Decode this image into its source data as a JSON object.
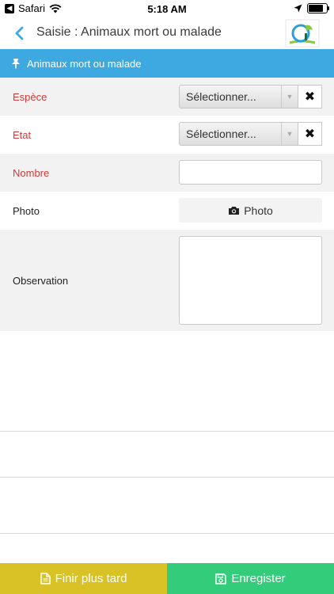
{
  "status_bar": {
    "app": "Safari",
    "time": "5:18 AM",
    "battery_level": 0.9
  },
  "nav": {
    "title": "Saisie : Animaux mort ou malade"
  },
  "section": {
    "title": "Animaux mort ou malade"
  },
  "form": {
    "espece": {
      "label": "Espèce",
      "value": "Sélectionner...",
      "clear": "✖"
    },
    "etat": {
      "label": "Etat",
      "value": "Sélectionner...",
      "clear": "✖"
    },
    "nombre": {
      "label": "Nombre",
      "value": ""
    },
    "photo": {
      "label": "Photo",
      "button": "Photo"
    },
    "observation": {
      "label": "Observation",
      "value": ""
    }
  },
  "footer": {
    "later_label": "Finir plus tard",
    "save_label": "Enregister"
  },
  "colors": {
    "header_blue": "#3da9e0",
    "required_red": "#d03a3a",
    "later_yellow": "#d8c225",
    "save_green": "#33cc7a"
  },
  "icons": {
    "back": "chevron-left-icon",
    "pin": "pushpin-icon",
    "camera": "camera-icon",
    "file": "file-icon",
    "save": "floppy-disk-icon"
  }
}
